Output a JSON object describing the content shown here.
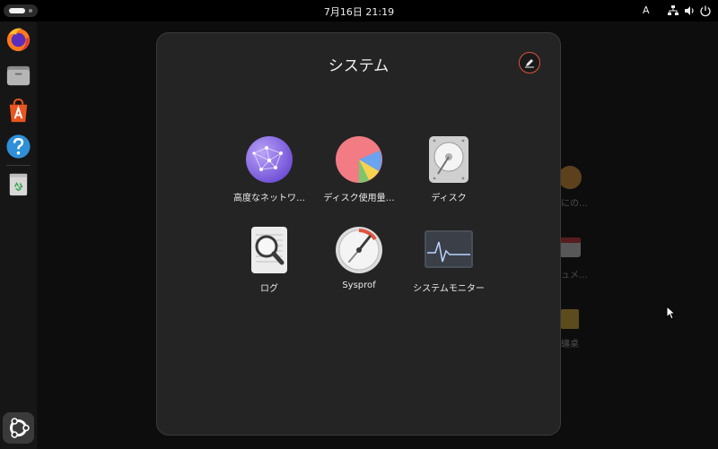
{
  "topbar": {
    "clock": "7月16日  21:19",
    "input_method": "A",
    "icons": [
      "network-icon",
      "volume-icon",
      "power-icon"
    ]
  },
  "dock": {
    "items": [
      "firefox-icon",
      "files-icon",
      "app-center-icon",
      "help-icon",
      "trash-icon",
      "show-apps-icon"
    ]
  },
  "background": {
    "labels": [
      "にの…",
      "ュメ…",
      "纏桌"
    ]
  },
  "folder": {
    "title": "システム",
    "apps": [
      {
        "label": "高度なネットワ…",
        "icon": "advanced-network-icon"
      },
      {
        "label": "ディスク使用量…",
        "icon": "disk-usage-icon"
      },
      {
        "label": "ディスク",
        "icon": "disks-icon"
      },
      {
        "label": "ログ",
        "icon": "logs-icon"
      },
      {
        "label": "Sysprof",
        "icon": "sysprof-icon"
      },
      {
        "label": "システムモニター",
        "icon": "system-monitor-icon"
      }
    ]
  },
  "colors": {
    "accent": "#e0533d",
    "folder_bg": "#242424",
    "dock_bg": "#161616"
  }
}
